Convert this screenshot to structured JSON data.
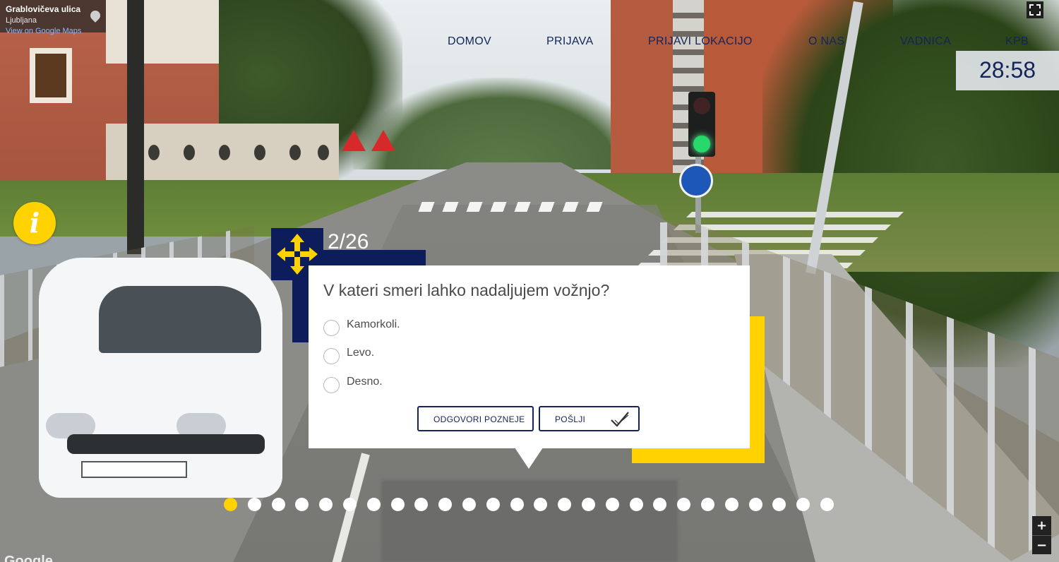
{
  "maps": {
    "street": "Grablovičeva ulica",
    "city": "Ljubljana",
    "view_link": "View on Google Maps",
    "logo": "Google"
  },
  "nav": {
    "items": [
      "DOMOV",
      "PRIJAVA",
      "PRIJAVI LOKACIJO",
      "O NAS",
      "VADNICA",
      "KPB"
    ]
  },
  "timer": "28:58",
  "info_button": "i",
  "quiz": {
    "counter": "2/26",
    "question": "V kateri smeri lahko nadaljujem vožnjo?",
    "options": [
      "Kamorkoli.",
      "Levo.",
      "Desno."
    ],
    "answer_later_label": "ODGOVORI POZNEJE",
    "submit_label": "POŠLJI",
    "total_questions": 26,
    "current_question": 2
  },
  "zoom": {
    "in": "+",
    "out": "−"
  },
  "colors": {
    "navy": "#0d1c5a",
    "yellow": "#ffd200",
    "text": "#14245a"
  },
  "icons": [
    "move-arrows-icon",
    "checkmark-icon",
    "map-pin-icon",
    "fullscreen-icon",
    "info-icon"
  ]
}
